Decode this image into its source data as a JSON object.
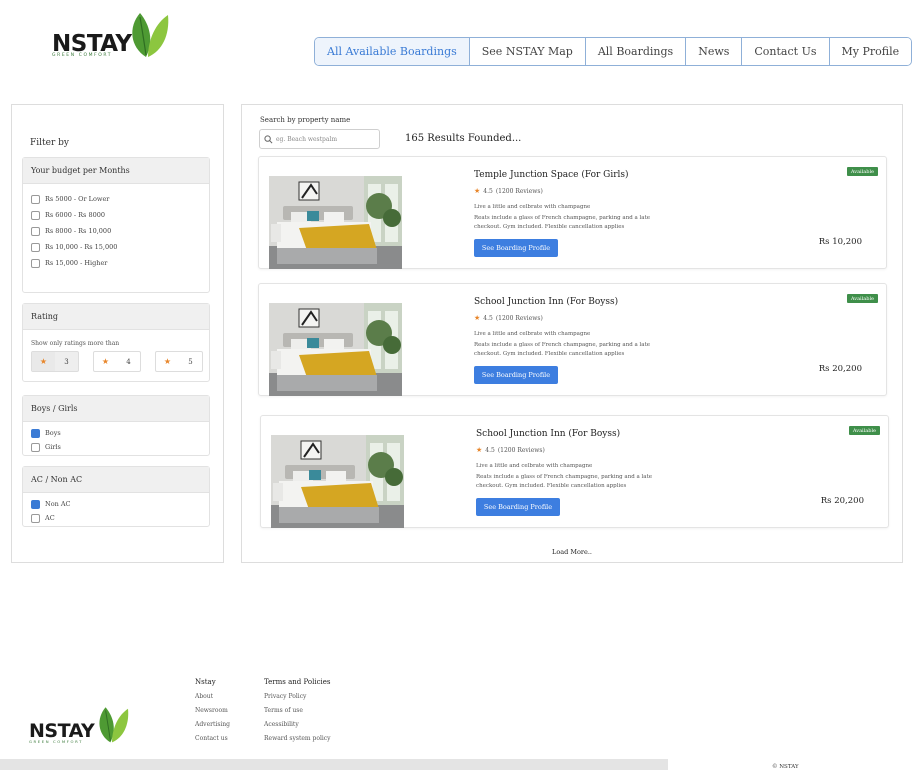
{
  "brand": {
    "name": "NSTAY",
    "tagline": "GREEN COMFORT"
  },
  "colors": {
    "accent": "#3a7bd5",
    "button": "#3d7ee0",
    "badge": "#3f8f4a",
    "star": "#e8862a",
    "leaf": "#5fa33a"
  },
  "nav": [
    {
      "label": "All Available Boardings",
      "active": true
    },
    {
      "label": "See NSTAY Map"
    },
    {
      "label": "All Boardings"
    },
    {
      "label": "News"
    },
    {
      "label": "Contact Us"
    },
    {
      "label": "My Profile"
    }
  ],
  "filter": {
    "title": "Filter by",
    "budget": {
      "heading": "Your budget per Months",
      "options": [
        {
          "label": "Rs 5000 -  Or Lower",
          "checked": false
        },
        {
          "label": "Rs 6000 - Rs 8000",
          "checked": false
        },
        {
          "label": "Rs 8000 - Rs 10,000",
          "checked": false
        },
        {
          "label": "Rs 10,000 - Rs 15,000",
          "checked": false
        },
        {
          "label": "Rs 15,000 - Higher",
          "checked": false
        }
      ]
    },
    "rating": {
      "heading": "Rating",
      "note": "Show only ratings more than",
      "options": [
        {
          "value": "3",
          "selected": true
        },
        {
          "value": "4",
          "selected": false
        },
        {
          "value": "5",
          "selected": false
        }
      ]
    },
    "gender": {
      "heading": "Boys / Girls",
      "options": [
        {
          "label": "Boys",
          "checked": true
        },
        {
          "label": "Girls",
          "checked": false
        }
      ]
    },
    "ac": {
      "heading": "AC / Non AC",
      "options": [
        {
          "label": "Non AC",
          "checked": true
        },
        {
          "label": "AC",
          "checked": false
        }
      ]
    }
  },
  "search": {
    "label": "Search by property name",
    "placeholder": "eg. Beach westpalm",
    "value": ""
  },
  "results": {
    "count_text": "165 Results Founded...",
    "listings": [
      {
        "title": "Temple Junction Space (For Girls)",
        "rating": "4.5",
        "reviews": "(1200 Reviews)",
        "desc1": "Live a little and celbrate with champagne",
        "desc2": "Reats include a glass of French champagne, parking and a late checkout. Gym included. Flexible cancellation applies",
        "button": "See Boarding Profile",
        "badge": "Available",
        "price": "Rs 10,200"
      },
      {
        "title": "School Junction Inn (For Boyss)",
        "rating": "4.5",
        "reviews": "(1200 Reviews)",
        "desc1": "Live a little and celbrate with champagne",
        "desc2": "Reats include a glass of French champagne, parking and a late checkout. Gym included. Flexible cancellation applies",
        "button": "See Boarding Profile",
        "badge": "Available",
        "price": "Rs 20,200"
      },
      {
        "title": "School Junction Inn (For Boyss)",
        "rating": "4.5",
        "reviews": "(1200 Reviews)",
        "desc1": "Live a little and celbrate with champagne",
        "desc2": "Reats include a glass of French champagne, parking and a late checkout. Gym included. Flexible cancellation applies",
        "button": "See Boarding Profile",
        "badge": "Available",
        "price": "Rs 20,200"
      }
    ],
    "load_more": "Load More.."
  },
  "footer": {
    "col1": {
      "heading": "Nstay",
      "links": [
        "About",
        "Newsroom",
        "Advertising",
        "Contact us"
      ]
    },
    "col2": {
      "heading": "Terms and Policies",
      "links": [
        "Privacy Policy",
        "Terms of use",
        "Acessibility",
        "Reward system policy"
      ]
    },
    "copyright": "© NSTAY"
  }
}
